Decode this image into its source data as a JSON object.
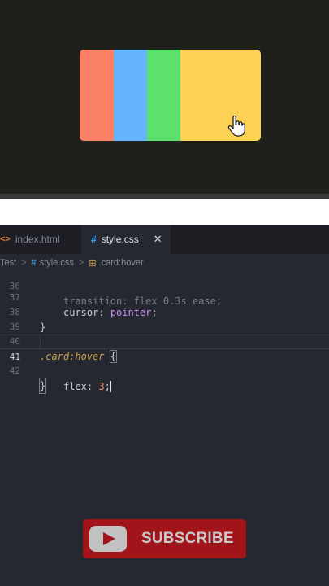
{
  "preview": {
    "cards": [
      {
        "color": "#fa8066"
      },
      {
        "color": "#64b4fe"
      },
      {
        "color": "#5de06d"
      },
      {
        "color": "#fcd155"
      }
    ],
    "cursor_icon": "hand-pointer-icon"
  },
  "editor": {
    "tabs": [
      {
        "label": "index.html",
        "icon": "<>",
        "active": false
      },
      {
        "label": "style.css",
        "icon": "#",
        "active": true,
        "close": "✕"
      }
    ],
    "breadcrumb": {
      "root": "Test",
      "sep": ">",
      "file": "style.css",
      "file_icon": "#",
      "selector": ".card:hover",
      "selector_icon": "⊞"
    },
    "lines": [
      {
        "num": "36",
        "text": "transition: flex 0.3s ease;"
      },
      {
        "num": "37",
        "prop": "cursor",
        "value": "pointer"
      },
      {
        "num": "38",
        "text": "}"
      },
      {
        "num": "39",
        "text": ""
      },
      {
        "num": "40",
        "selector": ".card:hover",
        "brace": "{"
      },
      {
        "num": "41",
        "prop": "flex",
        "value": "3"
      },
      {
        "num": "42",
        "text": "}"
      }
    ]
  },
  "subscribe": {
    "label": "SUBSCRIBE",
    "icon": "youtube-play-icon"
  }
}
